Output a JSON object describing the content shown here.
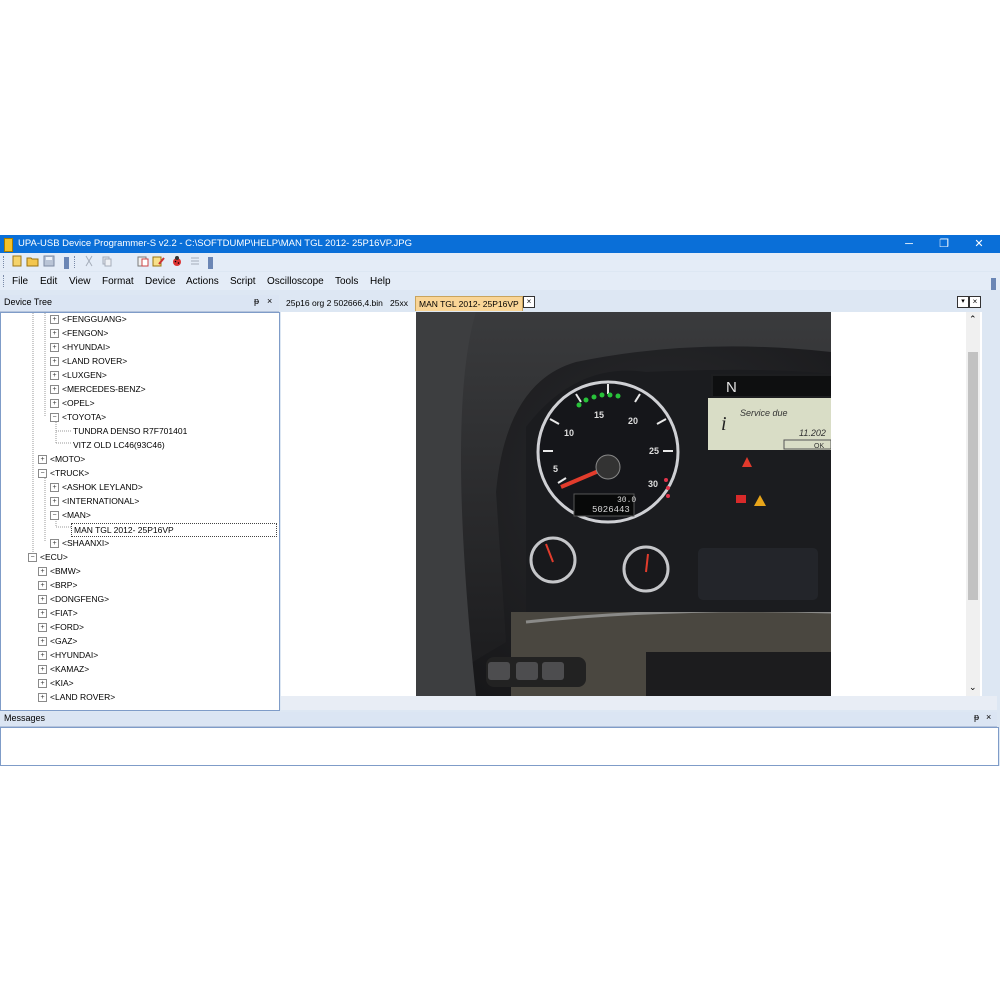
{
  "window": {
    "title": "UPA-USB Device Programmer-S v2.2 - C:\\SOFTDUMP\\HELP\\MAN TGL 2012- 25P16VP.JPG",
    "minimize": "─",
    "restore": "❐",
    "close": "✕"
  },
  "menu": [
    "File",
    "Edit",
    "View",
    "Format",
    "Device",
    "Actions",
    "Script",
    "Oscilloscope",
    "Tools",
    "Help"
  ],
  "device_tree": {
    "title": "Device Tree",
    "pin": "ᵽ",
    "close": "×",
    "nodes": [
      {
        "label": "<FENGGUANG>",
        "exp": "+"
      },
      {
        "label": "<FENGON>",
        "exp": "+"
      },
      {
        "label": "<HYUNDAI>",
        "exp": "+"
      },
      {
        "label": "<LAND ROVER>",
        "exp": "+"
      },
      {
        "label": "<LUXGEN>",
        "exp": "+"
      },
      {
        "label": "<MERCEDES-BENZ>",
        "exp": "+"
      },
      {
        "label": "<OPEL>",
        "exp": "+"
      },
      {
        "label": "<TOYOTA>",
        "exp": "−"
      },
      {
        "label": "TUNDRA DENSO R7F701401",
        "exp": ""
      },
      {
        "label": "VITZ OLD LC46(93C46)",
        "exp": ""
      },
      {
        "label": "<MOTO>",
        "exp": "+"
      },
      {
        "label": "<TRUCK>",
        "exp": "−"
      },
      {
        "label": "<ASHOK LEYLAND>",
        "exp": "+"
      },
      {
        "label": "<INTERNATIONAL>",
        "exp": "+"
      },
      {
        "label": "<MAN>",
        "exp": "−"
      },
      {
        "label": "MAN TGL 2012- 25P16VP",
        "exp": ""
      },
      {
        "label": "<SHAANXI>",
        "exp": "+"
      },
      {
        "label": "<ECU>",
        "exp": "−"
      },
      {
        "label": "<BMW>",
        "exp": "+"
      },
      {
        "label": "<BRP>",
        "exp": "+"
      },
      {
        "label": "<DONGFENG>",
        "exp": "+"
      },
      {
        "label": "<FIAT>",
        "exp": "+"
      },
      {
        "label": "<FORD>",
        "exp": "+"
      },
      {
        "label": "<GAZ>",
        "exp": "+"
      },
      {
        "label": "<HYUNDAI>",
        "exp": "+"
      },
      {
        "label": "<KAMAZ>",
        "exp": "+"
      },
      {
        "label": "<KIA>",
        "exp": "+"
      },
      {
        "label": "<LAND ROVER>",
        "exp": "+"
      }
    ]
  },
  "tabs": [
    "25p16 org 2 502666,4.bin",
    "25xx",
    "MAN TGL 2012- 25P16VP"
  ],
  "tab_close": "×",
  "photo": {
    "gear": "N",
    "info": "i",
    "service_text": "Service due",
    "date": "11.202",
    "ok": "OK",
    "trip": "30.0",
    "odometer": "5026443",
    "gauge_ticks": [
      "5",
      "10",
      "15",
      "20",
      "25",
      "30"
    ]
  },
  "messages": {
    "title": "Messages",
    "pin": "ᵽ",
    "close": "×"
  }
}
